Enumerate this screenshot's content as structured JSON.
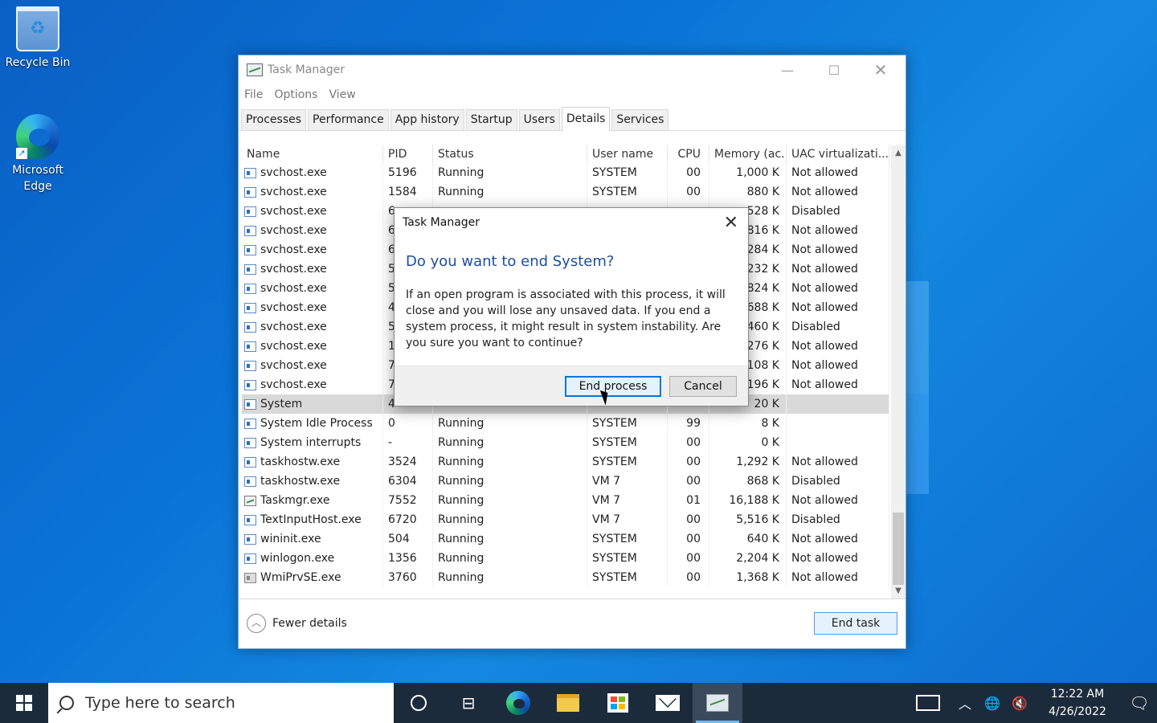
{
  "desktop": {
    "icons": [
      {
        "label": "Recycle Bin"
      },
      {
        "label": "Microsoft Edge"
      }
    ]
  },
  "window": {
    "title": "Task Manager",
    "controls": {
      "minimize": "—",
      "maximize": "☐",
      "close": "✕"
    },
    "menu": [
      "File",
      "Options",
      "View"
    ],
    "tabs": [
      "Processes",
      "Performance",
      "App history",
      "Startup",
      "Users",
      "Details",
      "Services"
    ],
    "active_tab": "Details",
    "columns": [
      "Name",
      "PID",
      "Status",
      "User name",
      "CPU",
      "Memory (ac...",
      "UAC virtualizati..."
    ],
    "rows": [
      {
        "name": "svchost.exe",
        "pid": "5196",
        "status": "Running",
        "user": "SYSTEM",
        "cpu": "00",
        "mem": "1,000 K",
        "uac": "Not allowed",
        "icon": "service"
      },
      {
        "name": "svchost.exe",
        "pid": "1584",
        "status": "Running",
        "user": "SYSTEM",
        "cpu": "00",
        "mem": "880 K",
        "uac": "Not allowed",
        "icon": "service"
      },
      {
        "name": "svchost.exe",
        "pid": "6",
        "status": "",
        "user": "",
        "cpu": "",
        "mem": ",528 K",
        "uac": "Disabled",
        "icon": "service"
      },
      {
        "name": "svchost.exe",
        "pid": "6",
        "status": "",
        "user": "",
        "cpu": "",
        "mem": ",816 K",
        "uac": "Not allowed",
        "icon": "service"
      },
      {
        "name": "svchost.exe",
        "pid": "6",
        "status": "",
        "user": "",
        "cpu": "",
        "mem": ",284 K",
        "uac": "Not allowed",
        "icon": "service"
      },
      {
        "name": "svchost.exe",
        "pid": "5",
        "status": "",
        "user": "",
        "cpu": "",
        "mem": ",232 K",
        "uac": "Not allowed",
        "icon": "service"
      },
      {
        "name": "svchost.exe",
        "pid": "5",
        "status": "",
        "user": "",
        "cpu": "",
        "mem": ",824 K",
        "uac": "Not allowed",
        "icon": "service"
      },
      {
        "name": "svchost.exe",
        "pid": "4",
        "status": "",
        "user": "",
        "cpu": "",
        "mem": ",688 K",
        "uac": "Not allowed",
        "icon": "service"
      },
      {
        "name": "svchost.exe",
        "pid": "5",
        "status": "",
        "user": "",
        "cpu": "",
        "mem": ",460 K",
        "uac": "Disabled",
        "icon": "service"
      },
      {
        "name": "svchost.exe",
        "pid": "1",
        "status": "",
        "user": "",
        "cpu": "",
        "mem": ",276 K",
        "uac": "Not allowed",
        "icon": "service"
      },
      {
        "name": "svchost.exe",
        "pid": "7",
        "status": "",
        "user": "",
        "cpu": "",
        "mem": ",108 K",
        "uac": "Not allowed",
        "icon": "service"
      },
      {
        "name": "svchost.exe",
        "pid": "7",
        "status": "",
        "user": "",
        "cpu": "",
        "mem": ",196 K",
        "uac": "Not allowed",
        "icon": "service"
      },
      {
        "name": "System",
        "pid": "4",
        "status": "",
        "user": "",
        "cpu": "",
        "mem": "20 K",
        "uac": "",
        "icon": "service",
        "selected": true
      },
      {
        "name": "System Idle Process",
        "pid": "0",
        "status": "Running",
        "user": "SYSTEM",
        "cpu": "99",
        "mem": "8 K",
        "uac": "",
        "icon": "service"
      },
      {
        "name": "System interrupts",
        "pid": "-",
        "status": "Running",
        "user": "SYSTEM",
        "cpu": "00",
        "mem": "0 K",
        "uac": "",
        "icon": "service"
      },
      {
        "name": "taskhostw.exe",
        "pid": "3524",
        "status": "Running",
        "user": "SYSTEM",
        "cpu": "00",
        "mem": "1,292 K",
        "uac": "Not allowed",
        "icon": "service"
      },
      {
        "name": "taskhostw.exe",
        "pid": "6304",
        "status": "Running",
        "user": "VM 7",
        "cpu": "00",
        "mem": "868 K",
        "uac": "Disabled",
        "icon": "service"
      },
      {
        "name": "Taskmgr.exe",
        "pid": "7552",
        "status": "Running",
        "user": "VM 7",
        "cpu": "01",
        "mem": "16,188 K",
        "uac": "Not allowed",
        "icon": "taskmgr"
      },
      {
        "name": "TextInputHost.exe",
        "pid": "6720",
        "status": "Running",
        "user": "VM 7",
        "cpu": "00",
        "mem": "5,516 K",
        "uac": "Disabled",
        "icon": "service"
      },
      {
        "name": "wininit.exe",
        "pid": "504",
        "status": "Running",
        "user": "SYSTEM",
        "cpu": "00",
        "mem": "640 K",
        "uac": "Not allowed",
        "icon": "service"
      },
      {
        "name": "winlogon.exe",
        "pid": "1356",
        "status": "Running",
        "user": "SYSTEM",
        "cpu": "00",
        "mem": "2,204 K",
        "uac": "Not allowed",
        "icon": "service"
      },
      {
        "name": "WmiPrvSE.exe",
        "pid": "3760",
        "status": "Running",
        "user": "SYSTEM",
        "cpu": "00",
        "mem": "1,368 K",
        "uac": "Not allowed",
        "icon": "wmi"
      }
    ],
    "fewer_details": "Fewer details",
    "end_task": "End task"
  },
  "dialog": {
    "title": "Task Manager",
    "heading": "Do you want to end System?",
    "body": "If an open program is associated with this process, it will close and you will lose any unsaved data. If you end a system process, it might result in system instability. Are you sure you want to continue?",
    "confirm_label": "End process",
    "cancel_label": "Cancel"
  },
  "taskbar": {
    "search_placeholder": "Type here to search",
    "time": "12:22 AM",
    "date": "4/26/2022"
  }
}
